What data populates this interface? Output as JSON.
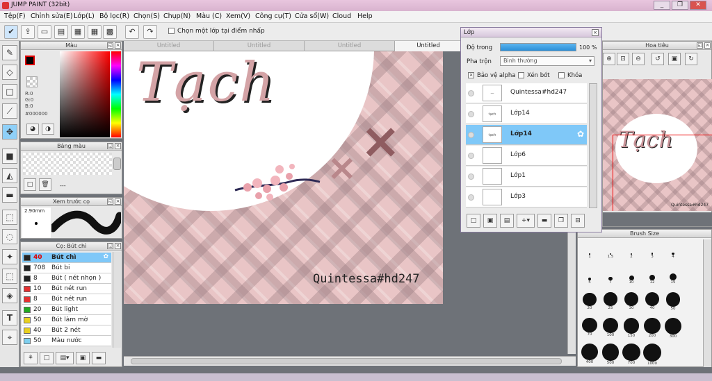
{
  "window": {
    "title": "JUMP PAINT (32bit)",
    "min": "_",
    "restore": "❐",
    "close": "✕"
  },
  "menu": [
    "Tệp(F)",
    "Chỉnh sửa(E)",
    "Lớp(L)",
    "Bộ lọc(R)",
    "Chọn(S)",
    "Chụp(N)",
    "Màu (C)",
    "Xem(V)",
    "Công cụ(T)",
    "Cửa sổ(W)",
    "Cloud",
    "Help"
  ],
  "toolbar": {
    "select_layer_label": "Chọn một lớp tại điểm nhấp"
  },
  "color_panel": {
    "title": "Màu",
    "r": "R:0",
    "g": "G:0",
    "b": "B:0",
    "hex": "#000000",
    "primary_color": "#000000"
  },
  "palette_panel": {
    "title": "Bảng màu",
    "footer": "---"
  },
  "brush_preview": {
    "title": "Xem trước cọ",
    "size": "2.90mm"
  },
  "brush_list": {
    "title": "Cọ: Bút chì",
    "items": [
      {
        "size": "40",
        "name": "Bút chì",
        "color": "#222222",
        "selected": true
      },
      {
        "size": "708",
        "name": "Bút bi",
        "color": "#222222"
      },
      {
        "size": "8",
        "name": "Bút ( nét nhọn )",
        "color": "#222222"
      },
      {
        "size": "10",
        "name": "Bút nét run",
        "color": "#e53030"
      },
      {
        "size": "8",
        "name": "Bút nét run",
        "color": "#e53030"
      },
      {
        "size": "20",
        "name": "Bút light",
        "color": "#22aa22"
      },
      {
        "size": "50",
        "name": "Bút làm mờ",
        "color": "#e8d020"
      },
      {
        "size": "40",
        "name": "Bút 2 nét",
        "color": "#e8d020"
      },
      {
        "size": "50",
        "name": "Màu nước",
        "color": "#7fd0f0"
      }
    ]
  },
  "canvas": {
    "tabs": [
      "Untitled",
      "Untitled",
      "Untitled",
      "Untitled"
    ],
    "art_title": "Tạch",
    "art_signature": "Quintessa#hd247"
  },
  "layer_panel": {
    "title": "Lớp",
    "opacity_label": "Độ trong",
    "opacity_value": "100 %",
    "opacity_fraction": 1.0,
    "blend_label": "Pha trộn",
    "blend_value": "Bình thường",
    "protect_alpha": "Bảo vệ alpha",
    "clip": "Xén bớt",
    "lock": "Khóa",
    "layers": [
      {
        "name": "Quintessa#hd247",
        "thumb": "—"
      },
      {
        "name": "Lớp14",
        "thumb": "tạch"
      },
      {
        "name": "Lớp14",
        "thumb": "tạch",
        "selected": true
      },
      {
        "name": "Lớp6",
        "thumb": ""
      },
      {
        "name": "Lớp1",
        "thumb": ""
      },
      {
        "name": "Lớp3",
        "thumb": ""
      }
    ]
  },
  "navigator": {
    "title": "Hoa tiêu",
    "art_title": "Tạch",
    "signature": "Quintessa#hd247"
  },
  "brush_size": {
    "title": "Brush Size",
    "sizes": [
      "1",
      "1.5",
      "2",
      "3",
      "4",
      "5",
      "7",
      "10",
      "12",
      "15",
      "20",
      "25",
      "30",
      "40",
      "50",
      "70",
      "100",
      "150",
      "200",
      "300",
      "400",
      "500",
      "700",
      "1000"
    ]
  }
}
